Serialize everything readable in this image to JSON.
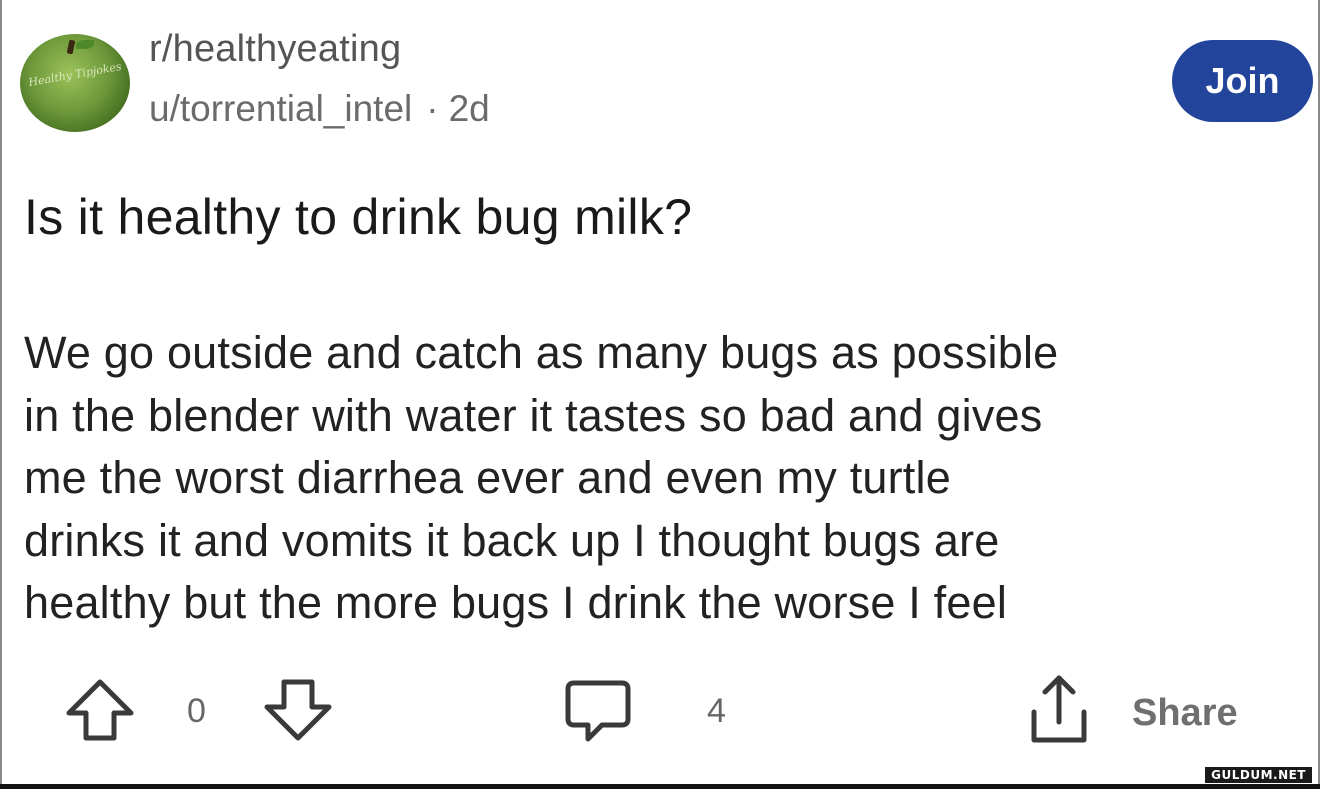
{
  "post": {
    "subreddit": "r/healthyeating",
    "author": "u/torrential_intel",
    "separator": "·",
    "age": "2d",
    "avatar_text": "Healthy Tipjokes",
    "join_label": "Join",
    "title": "Is it healthy to drink bug milk?",
    "body_lines": [
      "We go outside and catch as many bugs as possible",
      "in the blender with water it tastes so bad and gives",
      "me the worst diarrhea ever and even my turtle",
      "drinks it and vomits it back up I thought bugs are",
      "healthy but the more bugs I drink the worse I feel"
    ]
  },
  "actions": {
    "vote_count": "0",
    "comment_count": "4",
    "share_label": "Share"
  },
  "icons": {
    "upvote": "arrow-up-outline-icon",
    "downvote": "arrow-down-outline-icon",
    "comment": "speech-bubble-icon",
    "share": "share-upload-icon"
  },
  "colors": {
    "join_button": "#22449a",
    "text": "#1a1a1a",
    "meta": "#6b6b6b",
    "avatar_green": "#6f9a3b"
  },
  "watermark": "GULDUM.NET"
}
